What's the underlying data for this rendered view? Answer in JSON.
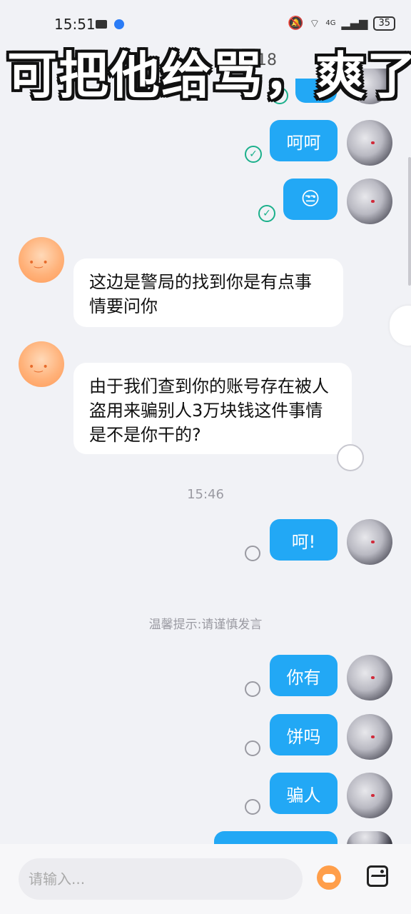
{
  "status_bar": {
    "time": "15:51",
    "network": "4G",
    "battery": "35"
  },
  "header": {
    "time_fragment": "18"
  },
  "caption": "可把他给骂，爽了",
  "messages": [
    {
      "from": "me",
      "text": "呵呵"
    },
    {
      "from": "me",
      "text": "😒"
    },
    {
      "from": "other",
      "text": "这边是警局的找到你是有点事情要问你"
    },
    {
      "from": "other",
      "text": "由于我们查到你的账号存在被人盗用来骗别人3万块钱这件事情是不是你干的?"
    },
    {
      "from": "me",
      "text": "呵!"
    },
    {
      "from": "me",
      "text": "你有"
    },
    {
      "from": "me",
      "text": "饼吗"
    },
    {
      "from": "me",
      "text": "骗人"
    }
  ],
  "timestamp": "15:46",
  "notice": "温馨提示:请谨慎发言",
  "input": {
    "placeholder": "请输入..."
  },
  "colors": {
    "my_bubble": "#22a8f5",
    "other_bubble": "#ffffff",
    "read_check": "#1bb08b",
    "background": "#f1f2f6"
  }
}
